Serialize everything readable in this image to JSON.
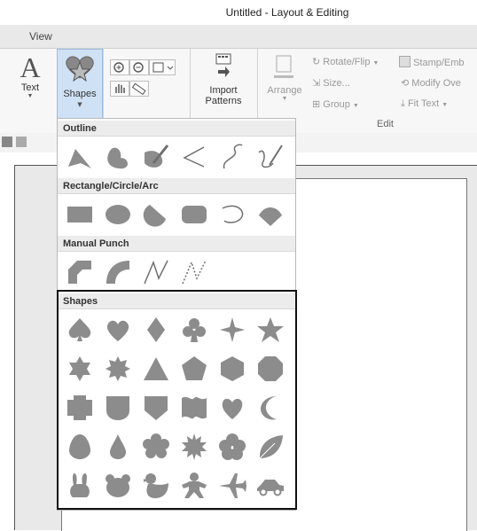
{
  "title": "Untitled - Layout & Editing",
  "ribbon": {
    "tab_view": "View",
    "text_label": "Text",
    "shapes_label": "Shapes",
    "import_label_line1": "Import",
    "import_label_line2": "Patterns",
    "arrange_label": "Arrange",
    "rotate_label": "Rotate/Flip",
    "stamp_label": "Stamp/Emb",
    "size_label": "Size...",
    "modify_label": "Modify Ove",
    "group_label": "Group",
    "fit_text_label": "Fit Text",
    "edit_group_label": "Edit"
  },
  "dropdown": {
    "sections": [
      {
        "label": "Outline",
        "items": [
          "outline-polygon-icon",
          "outline-curve-icon",
          "outline-brush-icon",
          "outline-open-line-icon",
          "outline-open-curve-icon",
          "outline-freehand-icon"
        ]
      },
      {
        "label": "Rectangle/Circle/Arc",
        "items": [
          "rectangle-icon",
          "circle-icon",
          "arc-icon",
          "rounded-rectangle-icon",
          "arc-open-icon",
          "fan-shape-icon"
        ]
      },
      {
        "label": "Manual Punch",
        "items": [
          "manual-punch-block-icon",
          "manual-punch-curve-icon",
          "manual-punch-line-icon",
          "manual-punch-dashed-line-icon"
        ]
      },
      {
        "label": "Shapes",
        "items": [
          "spade-icon",
          "heart-icon",
          "diamond-icon",
          "club-icon",
          "four-point-star-icon",
          "five-point-star-icon",
          "six-point-star-icon",
          "eight-point-star-icon",
          "triangle-icon",
          "pentagon-icon",
          "hexagon-icon",
          "octagon-icon",
          "cross-shape-icon",
          "shield-icon",
          "badge-icon",
          "flag-icon",
          "heart-outline-icon",
          "crescent-moon-icon",
          "egg-icon",
          "drop-icon",
          "cloud-icon",
          "burst-icon",
          "flower-icon",
          "leaf-icon",
          "rabbit-icon",
          "bear-icon",
          "duck-icon",
          "gingerbread-icon",
          "airplane-icon",
          "car-icon"
        ]
      }
    ]
  },
  "colors": {
    "icon_fill": "#8c8c8c",
    "ribbon_bg": "#f7f7f7",
    "active_bg": "#cfe1f5"
  }
}
